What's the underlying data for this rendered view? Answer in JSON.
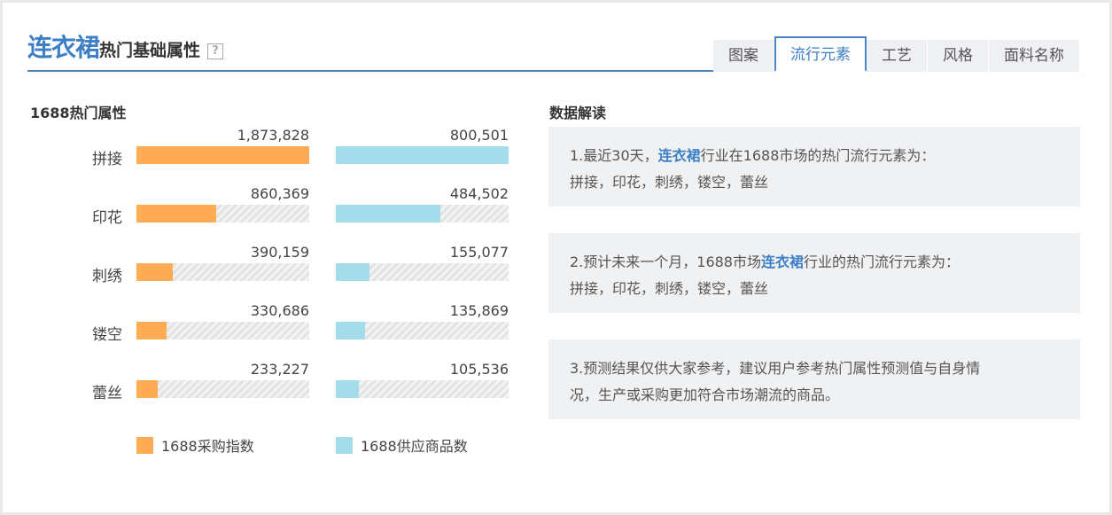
{
  "header": {
    "category": "连衣裙",
    "title_rest": "热门基础属性",
    "help_glyph": "?"
  },
  "tabs": [
    {
      "label": "图案",
      "active": false
    },
    {
      "label": "流行元素",
      "active": true
    },
    {
      "label": "工艺",
      "active": false
    },
    {
      "label": "风格",
      "active": false
    },
    {
      "label": "面料名称",
      "active": false
    }
  ],
  "left_section_title": "1688热门属性",
  "right_section_title": "数据解读",
  "colors": {
    "orange": "#ffac55",
    "blue": "#a3dcea",
    "accent": "#3d7fc7"
  },
  "chart_data": {
    "type": "bar",
    "categories": [
      "拼接",
      "印花",
      "刺绣",
      "镂空",
      "蕾丝"
    ],
    "series": [
      {
        "name": "1688采购指数",
        "values": [
          1873828,
          860369,
          390159,
          330686,
          233227
        ],
        "labels": [
          "1,873,828",
          "860,369",
          "390,159",
          "330,686",
          "233,227"
        ]
      },
      {
        "name": "1688供应商品数",
        "values": [
          800501,
          484502,
          155077,
          135869,
          105536
        ],
        "labels": [
          "800,501",
          "484,502",
          "155,077",
          "135,869",
          "105,536"
        ]
      }
    ]
  },
  "interpretation": [
    {
      "prefix": "1.最近30天，",
      "highlight": "连衣裙",
      "suffix": "行业在1688市场的热门流行元素为：",
      "line2": "拼接，印花，刺绣，镂空，蕾丝"
    },
    {
      "prefix": "2.预计未来一个月，1688市场",
      "highlight": "连衣裙",
      "suffix": "行业的热门流行元素为：",
      "line2": "拼接，印花，刺绣，镂空，蕾丝"
    },
    {
      "prefix": "3.预测结果仅供大家参考，建议用户参考热门属性预测值与自身情",
      "highlight": "",
      "suffix": "",
      "line2": "况，生产或采购更加符合市场潮流的商品。"
    }
  ]
}
